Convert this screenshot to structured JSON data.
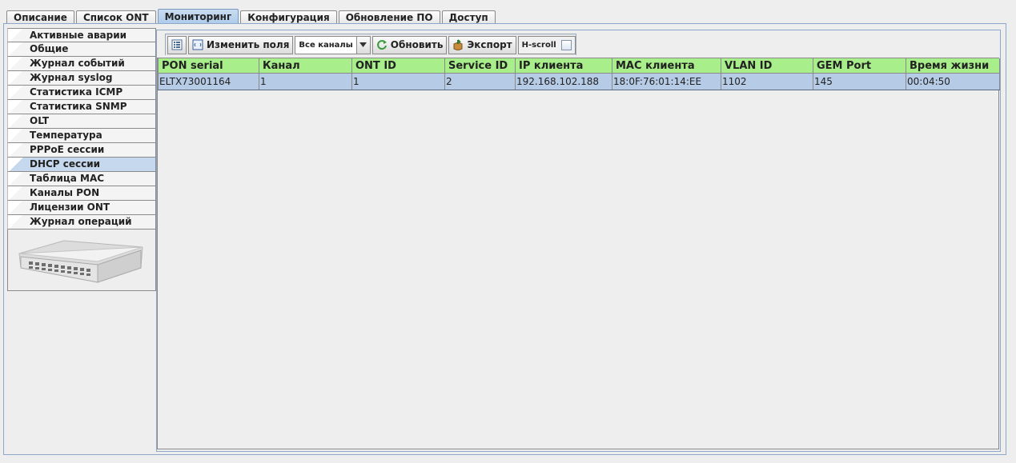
{
  "top_tabs": [
    {
      "label": "Описание",
      "active": false
    },
    {
      "label": "Список ONT",
      "active": false
    },
    {
      "label": "Мониторинг",
      "active": true
    },
    {
      "label": "Конфигурация",
      "active": false
    },
    {
      "label": "Обновление ПО",
      "active": false
    },
    {
      "label": "Доступ",
      "active": false
    }
  ],
  "sidebar": {
    "items": [
      {
        "label": "Активные аварии"
      },
      {
        "label": "Общие"
      },
      {
        "label": "Журнал событий"
      },
      {
        "label": "Журнал syslog"
      },
      {
        "label": "Статистика ICMP"
      },
      {
        "label": "Статистика SNMP"
      },
      {
        "label": "OLT"
      },
      {
        "label": "Температура"
      },
      {
        "label": "PPPoE сессии"
      },
      {
        "label": "DHCP сессии"
      },
      {
        "label": "Таблица MAC"
      },
      {
        "label": "Каналы PON"
      },
      {
        "label": "Лицензии ONT"
      },
      {
        "label": "Журнал операций"
      }
    ],
    "active_index": 9
  },
  "toolbar": {
    "edit_fields_label": "Изменить поля",
    "channel_select_value": "Все каналы",
    "refresh_label": "Обновить",
    "export_label": "Экспорт",
    "hscroll_label": "H-scroll",
    "hscroll_checked": false
  },
  "table": {
    "columns": [
      "PON serial",
      "Канал",
      "ONT ID",
      "Service ID",
      "IP клиента",
      "MAC клиента",
      "VLAN ID",
      "GEM Port",
      "Время жизни"
    ],
    "rows": [
      [
        "ELTX73001164",
        "1",
        "1",
        "2",
        "192.168.102.188",
        "18:0F:76:01:14:EE",
        "1102",
        "145",
        "00:04:50"
      ]
    ]
  },
  "colors": {
    "header_bg": "#a8ee8a",
    "selected_row_bg": "#b6cbe6",
    "active_tab_bg": "#aecbeb"
  }
}
